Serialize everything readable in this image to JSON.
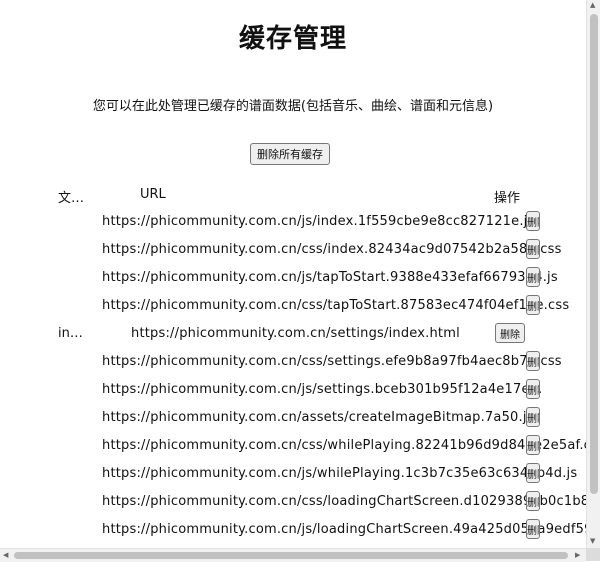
{
  "title": "缓存管理",
  "description": "您可以在此处管理已缓存的谱面数据(包括音乐、曲绘、谱面和元信息)",
  "delete_all_label": "删除所有缓存",
  "table": {
    "headers": {
      "file": "文…",
      "url": "URL",
      "action": "操作"
    },
    "delete_label": "删除",
    "rows": [
      {
        "file": "",
        "url": "https://phicommunity.com.cn/js/index.1f559cbe9e8cc827121e.js"
      },
      {
        "file": "",
        "url": "https://phicommunity.com.cn/css/index.82434ac9d07542b2a584.css"
      },
      {
        "file": "",
        "url": "https://phicommunity.com.cn/js/tapToStart.9388e433efaf6679384.js"
      },
      {
        "file": "",
        "url": "https://phicommunity.com.cn/css/tapToStart.87583ec474f04ef15e.css"
      },
      {
        "file": "in…",
        "url": "https://phicommunity.com.cn/settings/index.html"
      },
      {
        "file": "",
        "url": "https://phicommunity.com.cn/css/settings.efe9b8a97fb4aec8b75.css"
      },
      {
        "file": "",
        "url": "https://phicommunity.com.cn/js/settings.bceb301b95f12a4e17e5."
      },
      {
        "file": "",
        "url": "https://phicommunity.com.cn/assets/createImageBitmap.7a50.js"
      },
      {
        "file": "",
        "url": "https://phicommunity.com.cn/css/whilePlaying.82241b96d9d844e2e5af.c"
      },
      {
        "file": "",
        "url": "https://phicommunity.com.cn/js/whilePlaying.1c3b7c35e63c6347b4d.js"
      },
      {
        "file": "",
        "url": "https://phicommunity.com.cn/css/loadingChartScreen.d1029389ab0c1b8"
      },
      {
        "file": "",
        "url": "https://phicommunity.com.cn/js/loadingChartScreen.49a425d057a9edf59"
      }
    ]
  },
  "scrollbar_arrows": {
    "up": "▲",
    "down": "▼",
    "left": "◀",
    "right": "▶"
  }
}
